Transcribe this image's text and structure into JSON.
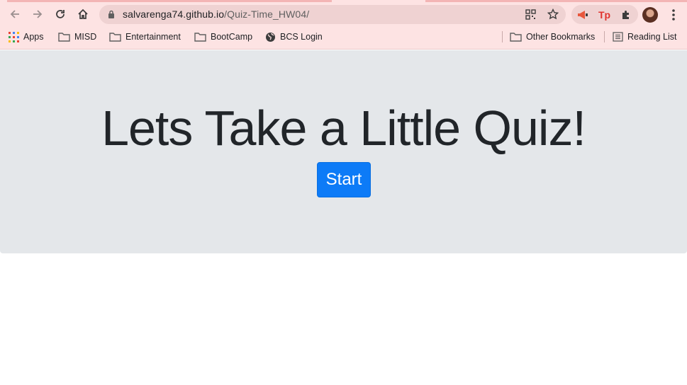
{
  "browser": {
    "url_host": "salvarenga74.github.io",
    "url_path": "/Quiz-Time_HW04/"
  },
  "bookmarks": {
    "items": [
      {
        "label": "Apps",
        "icon": "apps-grid-icon"
      },
      {
        "label": "MISD",
        "icon": "folder-icon"
      },
      {
        "label": "Entertainment",
        "icon": "folder-icon"
      },
      {
        "label": "BootCamp",
        "icon": "folder-icon"
      },
      {
        "label": "BCS Login",
        "icon": "globe-icon"
      }
    ],
    "other": "Other Bookmarks",
    "reading_list": "Reading List"
  },
  "page": {
    "headline": "Lets Take a Little Quiz!",
    "start_label": "Start"
  },
  "colors": {
    "chrome_bg": "#fde3e3",
    "jumbotron_bg": "#e4e7ea",
    "primary_button": "#0d7bf7"
  }
}
